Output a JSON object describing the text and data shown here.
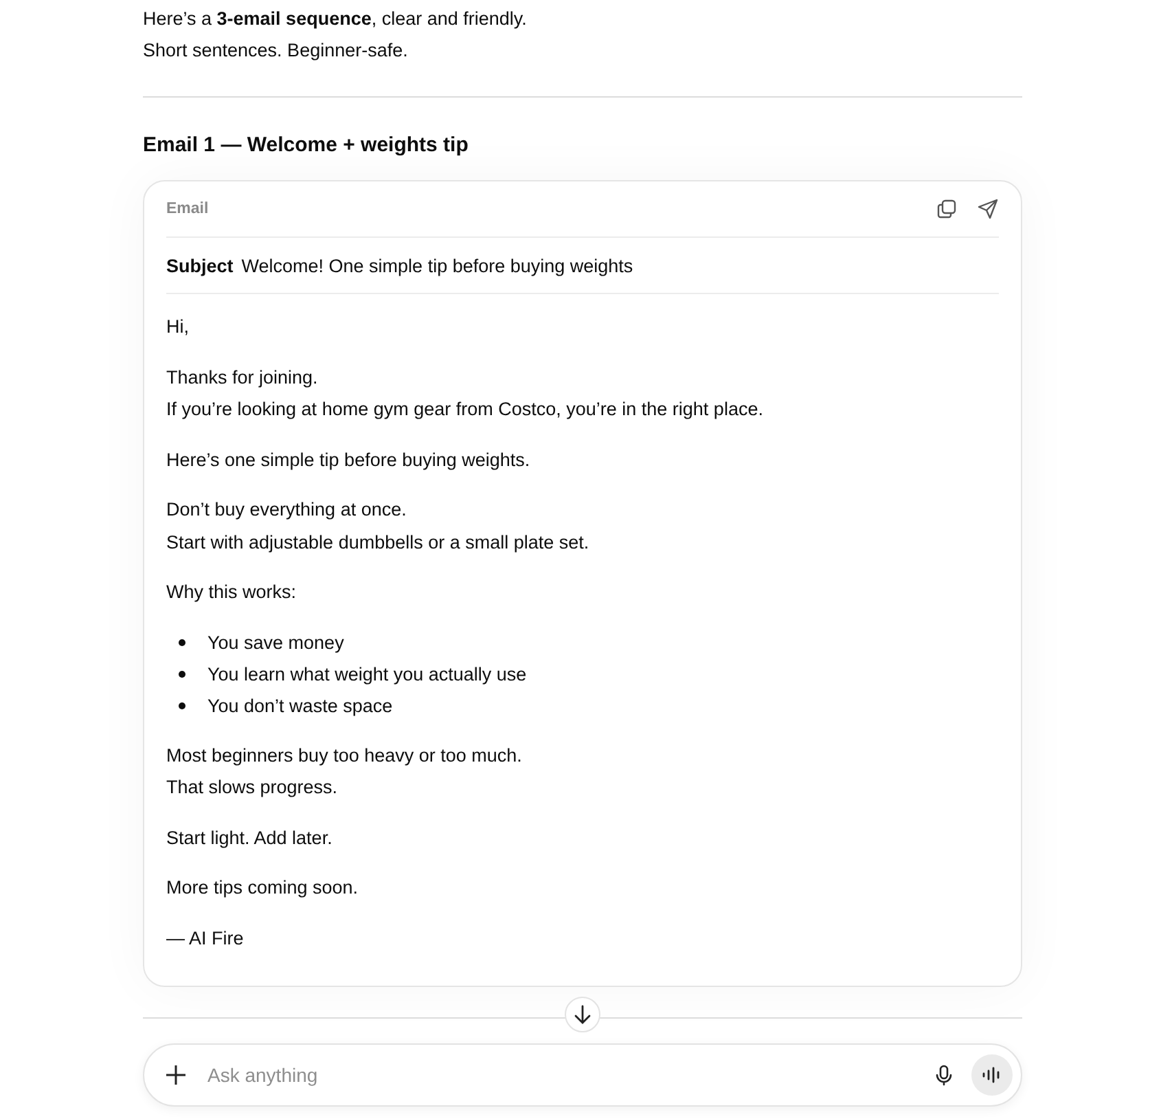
{
  "intro": [
    "Here’s a **3-email sequence**, clear and friendly.",
    "Short sentences. Beginner-safe."
  ],
  "email_heading": "Email 1 — Welcome + weights tip",
  "email_card": {
    "label": "Email",
    "subject_label": "Subject",
    "subject": "Welcome! One simple tip before buying weights",
    "body": [
      {
        "kind": "paragraph",
        "lines": [
          "Hi,"
        ]
      },
      {
        "kind": "paragraph",
        "lines": [
          "Thanks for joining.",
          "If you’re looking at home gym gear from Costco, you’re in the right place."
        ]
      },
      {
        "kind": "paragraph",
        "lines": [
          "Here’s one simple tip before buying weights."
        ]
      },
      {
        "kind": "paragraph",
        "lines": [
          "Don’t buy everything at once.",
          "Start with adjustable dumbbells or a small plate set."
        ]
      },
      {
        "kind": "paragraph",
        "lines": [
          "Why this works:"
        ]
      },
      {
        "kind": "list",
        "lines": [
          "You save money",
          "You learn what weight you actually use",
          "You don’t waste space"
        ]
      },
      {
        "kind": "paragraph",
        "lines": [
          "Most beginners buy too heavy or too much.",
          "That slows progress."
        ]
      },
      {
        "kind": "paragraph",
        "lines": [
          "Start light. Add later."
        ]
      },
      {
        "kind": "paragraph",
        "lines": [
          "More tips coming soon."
        ]
      },
      {
        "kind": "paragraph",
        "lines": [
          "— AI Fire"
        ]
      }
    ]
  },
  "composer": {
    "placeholder": "Ask anything"
  }
}
